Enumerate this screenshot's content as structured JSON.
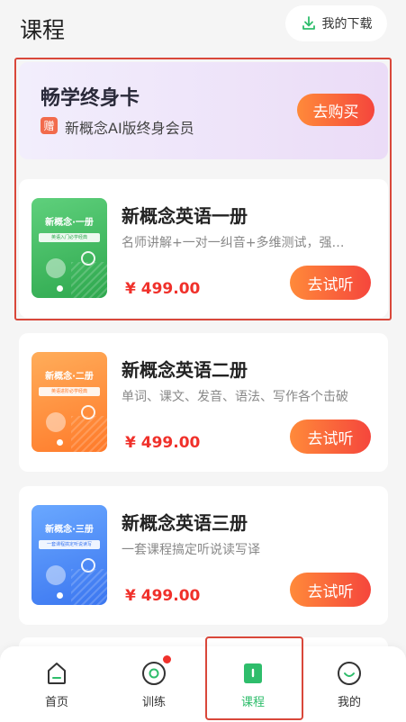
{
  "header": {
    "title": "课程",
    "download_label": "我的下载"
  },
  "vip": {
    "title": "畅学终身卡",
    "gift_badge": "赠",
    "subtitle": "新概念AI版终身会员",
    "buy_label": "去购买"
  },
  "courses": [
    {
      "cover_title": "新概念·一册",
      "cover_tag": "英语入门必学经典",
      "title": "新概念英语一册",
      "desc": "名师讲解+一对一纠音+多维测试，强…",
      "price": "¥ 499.00",
      "button": "去试听"
    },
    {
      "cover_title": "新概念·二册",
      "cover_tag": "英语进阶必学经典",
      "title": "新概念英语二册",
      "desc": "单词、课文、发音、语法、写作各个击破",
      "price": "¥ 499.00",
      "button": "去试听"
    },
    {
      "cover_title": "新概念·三册",
      "cover_tag": "一套课程搞定听说读写",
      "title": "新概念英语三册",
      "desc": "一套课程搞定听说读写译",
      "price": "¥ 499.00",
      "button": "去试听"
    }
  ],
  "tabbar": {
    "items": [
      {
        "label": "首页",
        "icon": "home-icon"
      },
      {
        "label": "训练",
        "icon": "training-icon"
      },
      {
        "label": "课程",
        "icon": "course-icon"
      },
      {
        "label": "我的",
        "icon": "profile-icon"
      }
    ],
    "active_index": 2
  },
  "colors": {
    "accent_green": "#2ebd6b",
    "price_red": "#f0312b",
    "button_gradient_start": "#ff8a3a",
    "button_gradient_end": "#f5463c",
    "highlight_red": "#d9473a"
  }
}
